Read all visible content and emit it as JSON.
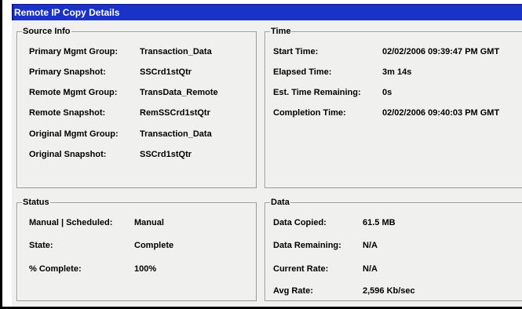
{
  "window": {
    "title": "Remote IP Copy Details"
  },
  "source_info": {
    "legend": "Source Info",
    "rows": [
      {
        "label": "Primary Mgmt Group:",
        "value": "Transaction_Data"
      },
      {
        "label": "Primary Snapshot:",
        "value": "SSCrd1stQtr"
      },
      {
        "label": "Remote Mgmt Group:",
        "value": "TransData_Remote"
      },
      {
        "label": "Remote Snapshot:",
        "value": "RemSSCrd1stQtr"
      },
      {
        "label": "Original Mgmt Group:",
        "value": "Transaction_Data"
      },
      {
        "label": "Original Snapshot:",
        "value": "SSCrd1stQtr"
      }
    ]
  },
  "time": {
    "legend": "Time",
    "rows": [
      {
        "label": "Start Time:",
        "value": "02/02/2006 09:39:47 PM GMT"
      },
      {
        "label": "Elapsed Time:",
        "value": "3m 14s"
      },
      {
        "label": "Est. Time Remaining:",
        "value": "0s"
      },
      {
        "label": "Completion Time:",
        "value": "02/02/2006 09:40:03 PM GMT"
      }
    ]
  },
  "status": {
    "legend": "Status",
    "rows": [
      {
        "label": "Manual | Scheduled:",
        "value": "Manual"
      },
      {
        "label": "State:",
        "value": "Complete"
      },
      {
        "label": "% Complete:",
        "value": "100%"
      }
    ]
  },
  "data": {
    "legend": "Data",
    "rows": [
      {
        "label": "Data Copied:",
        "value": "61.5 MB"
      },
      {
        "label": "Data Remaining:",
        "value": "N/A"
      },
      {
        "label": "Current Rate:",
        "value": "N/A"
      },
      {
        "label": "Avg Rate:",
        "value": "2,596 Kb/sec"
      }
    ]
  }
}
